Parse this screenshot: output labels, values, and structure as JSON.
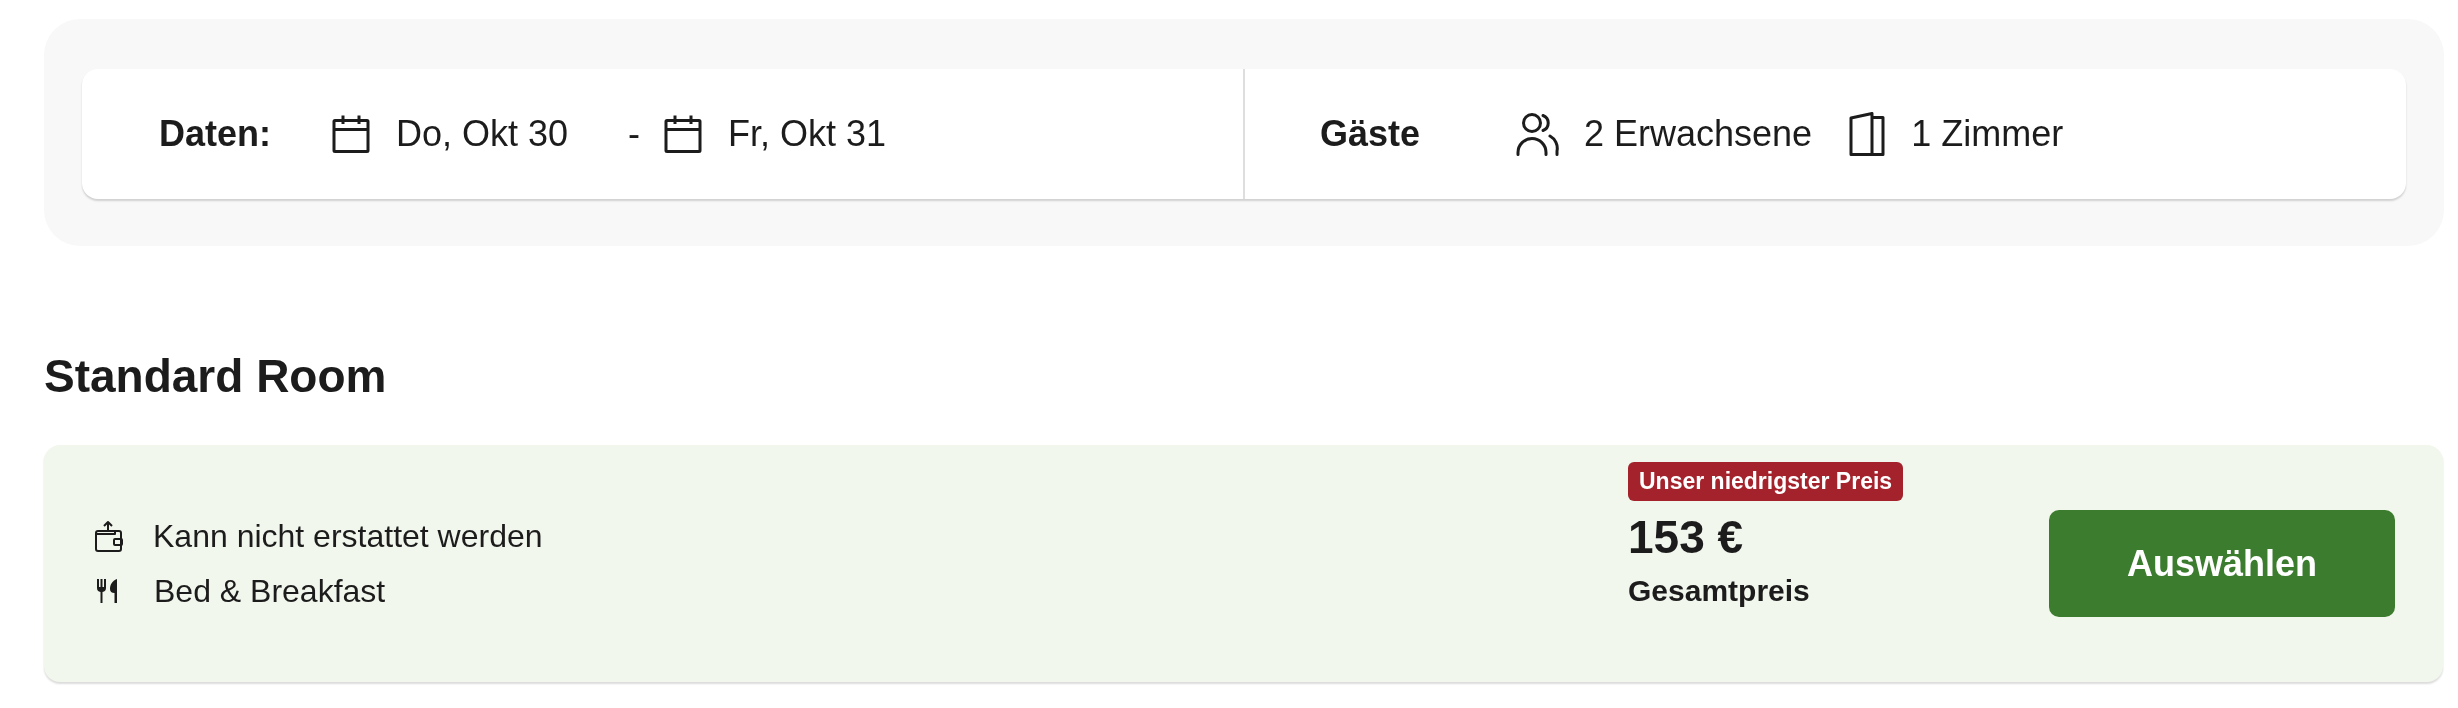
{
  "search_bar": {
    "dates": {
      "label": "Daten:",
      "check_in": "Do, Okt 30",
      "separator": "-",
      "check_out": "Fr, Okt 31"
    },
    "guests": {
      "label": "Gäste",
      "adults": "2 Erwachsene",
      "rooms": "1 Zimmer"
    }
  },
  "room": {
    "title": "Standard Room",
    "features": [
      {
        "kind": "refund",
        "text": "Kann nicht erstattet werden"
      },
      {
        "kind": "meal",
        "text": "Bed & Breakfast"
      }
    ],
    "badge": "Unser niedrigster Preis",
    "price": "153 €",
    "price_label": "Gesamtpreis",
    "button": "Auswählen"
  }
}
